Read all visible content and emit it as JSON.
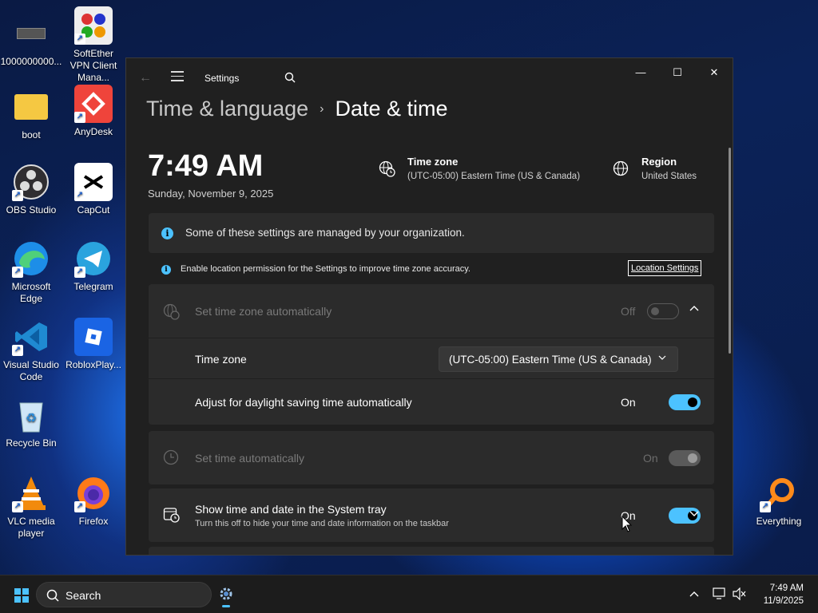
{
  "desktop": {
    "icons": [
      {
        "label": "1000000000..."
      },
      {
        "label": "SoftEther VPN Client Mana..."
      },
      {
        "label": "boot"
      },
      {
        "label": "AnyDesk"
      },
      {
        "label": "OBS Studio"
      },
      {
        "label": "CapCut"
      },
      {
        "label": "Microsoft Edge"
      },
      {
        "label": "Telegram"
      },
      {
        "label": "Visual Studio Code"
      },
      {
        "label": "RobloxPlay..."
      },
      {
        "label": "Recycle Bin"
      },
      {
        "label": "VLC media player"
      },
      {
        "label": "Firefox"
      },
      {
        "label": "Everything"
      }
    ]
  },
  "window": {
    "app_title": "Settings",
    "breadcrumb": {
      "parent": "Time & language",
      "separator": "›",
      "current": "Date & time"
    },
    "time": "7:49 AM",
    "date": "Sunday, November 9, 2025",
    "timezone_block": {
      "title": "Time zone",
      "value": "(UTC-05:00) Eastern Time (US & Canada)",
      "icon": "globe-clock-icon"
    },
    "region_block": {
      "title": "Region",
      "value": "United States",
      "icon": "globe-icon"
    },
    "notice": "Some of these settings are managed by your organization.",
    "location_notice": "Enable location permission for the Settings to improve time zone accuracy.",
    "location_button": "Location Settings",
    "settings": {
      "auto_timezone": {
        "label": "Set time zone automatically",
        "status": "Off"
      },
      "timezone": {
        "label": "Time zone",
        "value": "(UTC-05:00) Eastern Time (US & Canada)"
      },
      "dst": {
        "label": "Adjust for daylight saving time automatically",
        "status": "On"
      },
      "auto_time": {
        "label": "Set time automatically",
        "status": "On"
      },
      "tray": {
        "label": "Show time and date in the System tray",
        "sub": "Turn this off to hide your time and date information on the taskbar",
        "status": "On"
      }
    }
  },
  "taskbar": {
    "search_label": "Search",
    "clock_time": "7:49 AM",
    "clock_date": "11/9/2025"
  },
  "colors": {
    "accent": "#4cc2ff",
    "window_bg": "#202020",
    "card_bg": "#2b2b2b"
  }
}
